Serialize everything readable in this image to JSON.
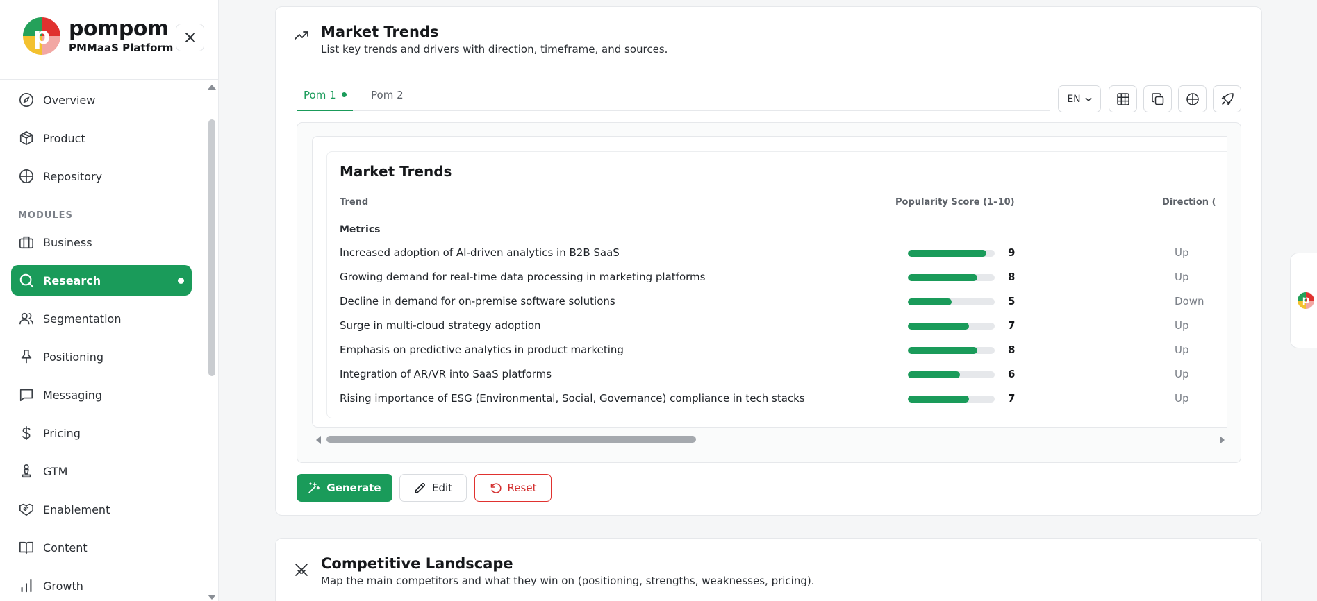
{
  "brand": {
    "name": "pompom",
    "subtitle": "PMMaaS Platform",
    "logo_letter": "p"
  },
  "sidebar": {
    "top_items": [
      {
        "label": "Overview",
        "icon": "compass-icon"
      },
      {
        "label": "Product",
        "icon": "box-icon"
      },
      {
        "label": "Repository",
        "icon": "globe-icon"
      }
    ],
    "section_label": "MODULES",
    "modules": [
      {
        "label": "Business",
        "icon": "briefcase-icon"
      },
      {
        "label": "Research",
        "icon": "search-icon",
        "active": true
      },
      {
        "label": "Segmentation",
        "icon": "users-icon"
      },
      {
        "label": "Positioning",
        "icon": "pin-icon"
      },
      {
        "label": "Messaging",
        "icon": "message-icon"
      },
      {
        "label": "Pricing",
        "icon": "dollar-icon"
      },
      {
        "label": "GTM",
        "icon": "chess-icon"
      },
      {
        "label": "Enablement",
        "icon": "handshake-icon"
      },
      {
        "label": "Content",
        "icon": "book-icon"
      },
      {
        "label": "Growth",
        "icon": "bar-chart-icon"
      }
    ]
  },
  "market_trends": {
    "title": "Market Trends",
    "description": "List key trends and drivers with direction, timeframe, and sources.",
    "tabs": [
      {
        "label": "Pom 1"
      },
      {
        "label": "Pom 2"
      }
    ],
    "language": "EN",
    "table": {
      "title": "Market Trends",
      "columns": {
        "trend": "Trend",
        "score": "Popularity Score (1–10)",
        "direction": "Direction ("
      },
      "group": "Metrics",
      "max_score": 10,
      "rows": [
        {
          "trend": "Increased adoption of AI-driven analytics in B2B SaaS",
          "score": 9,
          "direction": "Up"
        },
        {
          "trend": "Growing demand for real-time data processing in marketing platforms",
          "score": 8,
          "direction": "Up"
        },
        {
          "trend": "Decline in demand for on-premise software solutions",
          "score": 5,
          "direction": "Down"
        },
        {
          "trend": "Surge in multi-cloud strategy adoption",
          "score": 7,
          "direction": "Up"
        },
        {
          "trend": "Emphasis on predictive analytics in product marketing",
          "score": 8,
          "direction": "Up"
        },
        {
          "trend": "Integration of AR/VR into SaaS platforms",
          "score": 6,
          "direction": "Up"
        },
        {
          "trend": "Rising importance of ESG (Environmental, Social, Governance) compliance in tech stacks",
          "score": 7,
          "direction": "Up"
        }
      ]
    },
    "buttons": {
      "generate": "Generate",
      "edit": "Edit",
      "reset": "Reset"
    }
  },
  "competitive_landscape": {
    "title": "Competitive Landscape",
    "description": "Map the main competitors and what they win on (positioning, strengths, weaknesses, pricing)."
  },
  "colors": {
    "accent": "#1a9b5a",
    "danger": "#d32f2f"
  }
}
